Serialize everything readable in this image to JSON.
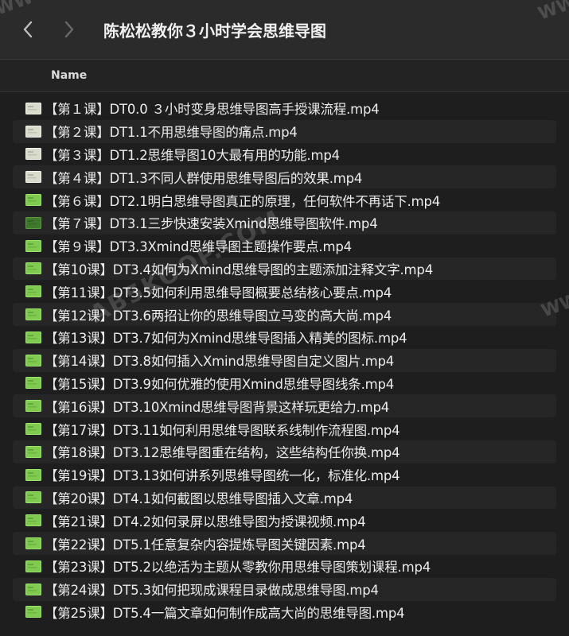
{
  "window": {
    "title": "陈松松教你３小时学会思维导图"
  },
  "list_header": {
    "name_label": "Name"
  },
  "files": [
    {
      "name": "【第１课】DT0.0 ３小时变身思维导图高手授课流程.mp4",
      "icon": "video-thumbnail-light"
    },
    {
      "name": "【第２课】DT1.1不用思维导图的痛点.mp4",
      "icon": "video-thumbnail-light"
    },
    {
      "name": "【第３课】DT1.2思维导图10大最有用的功能.mp4",
      "icon": "video-thumbnail-light"
    },
    {
      "name": "【第４课】DT1.3不同人群使用思维导图后的效果.mp4",
      "icon": "video-thumbnail-light"
    },
    {
      "name": "【第６课】DT2.1明白思维导图真正的原理，任何软件不再话下.mp4",
      "icon": "video-thumbnail-green"
    },
    {
      "name": "【第７课】DT3.1三步快速安装Xmind思维导图软件.mp4",
      "icon": "video-thumbnail-dark-green"
    },
    {
      "name": "【第９课】DT3.3Xmind思维导图主题操作要点.mp4",
      "icon": "video-thumbnail-green"
    },
    {
      "name": "【第10课】DT3.4如何为Xmind思维导图的主题添加注释文字.mp4",
      "icon": "video-thumbnail-green"
    },
    {
      "name": "【第11课】DT3.5如何利用思维导图概要总结核心要点.mp4",
      "icon": "video-thumbnail-green"
    },
    {
      "name": "【第12课】DT3.6两招让你的思维导图立马变的高大尚.mp4",
      "icon": "video-thumbnail-green"
    },
    {
      "name": "【第13课】DT3.7如何为Xmind思维导图插入精美的图标.mp4",
      "icon": "video-thumbnail-green"
    },
    {
      "name": "【第14课】DT3.8如何插入Xmind思维导图自定义图片.mp4",
      "icon": "video-thumbnail-green"
    },
    {
      "name": "【第15课】DT3.9如何优雅的使用Xmind思维导图线条.mp4",
      "icon": "video-thumbnail-green"
    },
    {
      "name": "【第16课】DT3.10Xmind思维导图背景这样玩更给力.mp4",
      "icon": "video-thumbnail-green"
    },
    {
      "name": "【第17课】DT3.11如何利用思维导图联系线制作流程图.mp4",
      "icon": "video-thumbnail-green"
    },
    {
      "name": "【第18课】DT3.12思维导图重在结构，这些结构任你换.mp4",
      "icon": "video-thumbnail-green"
    },
    {
      "name": "【第19课】DT3.13如何讲系列思维导图统一化，标准化.mp4",
      "icon": "video-thumbnail-green"
    },
    {
      "name": "【第20课】DT4.1如何截图以思维导图插入文章.mp4",
      "icon": "video-thumbnail-green"
    },
    {
      "name": "【第21课】DT4.2如何录屏以思维导图为授课视频.mp4",
      "icon": "video-thumbnail-green"
    },
    {
      "name": "【第22课】DT5.1任意复杂内容提炼导图关键因素.mp4",
      "icon": "video-thumbnail-green"
    },
    {
      "name": "【第23课】DT5.2以绝活为主题从零教你用思维导图策划课程.mp4",
      "icon": "video-thumbnail-green"
    },
    {
      "name": "【第24课】DT5.3如何把现成课程目录做成思维导图.mp4",
      "icon": "video-thumbnail-green"
    },
    {
      "name": "【第25课】DT5.4一篇文章如何制作成高大尚的思维导图.mp4",
      "icon": "video-thumbnail-green"
    }
  ],
  "watermark": {
    "text": "AB5KOOP.COM",
    "corner_text": "WW"
  },
  "colors": {
    "thumb_light": "#d9dccd",
    "thumb_green": "#7ecb4e",
    "thumb_dark_green": "#3f7a2c"
  }
}
